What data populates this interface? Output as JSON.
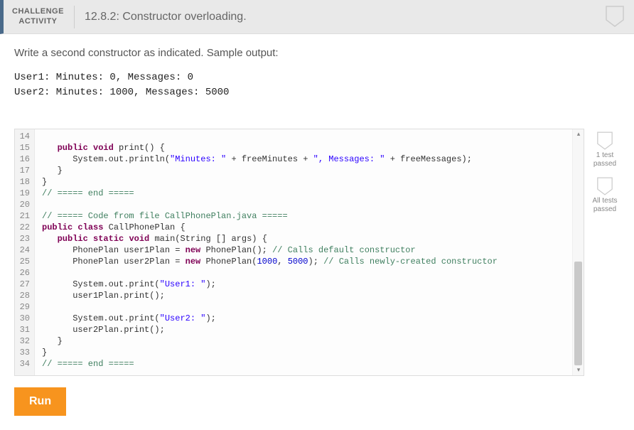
{
  "header": {
    "label_line1": "CHALLENGE",
    "label_line2": "ACTIVITY",
    "title": "12.8.2: Constructor overloading."
  },
  "instructions": "Write a second constructor as indicated. Sample output:",
  "sample_output": "User1: Minutes: 0, Messages: 0\nUser2: Minutes: 1000, Messages: 5000",
  "editor": {
    "first_line_number": 14,
    "lines": [
      [],
      [
        [
          "   ",
          ""
        ],
        [
          "public",
          "kw"
        ],
        [
          " ",
          ""
        ],
        [
          "void",
          "kw"
        ],
        [
          " print() {",
          ""
        ]
      ],
      [
        [
          "      System.out.println(",
          ""
        ],
        [
          "\"Minutes: \"",
          "str"
        ],
        [
          " + freeMinutes + ",
          ""
        ],
        [
          "\", Messages: \"",
          "str"
        ],
        [
          " + freeMessages);",
          ""
        ]
      ],
      [
        [
          "   }",
          ""
        ]
      ],
      [
        [
          "}",
          ""
        ]
      ],
      [
        [
          "// ===== end =====",
          "cmt"
        ]
      ],
      [],
      [
        [
          "// ===== Code from file CallPhonePlan.java =====",
          "cmt"
        ]
      ],
      [
        [
          "public",
          "kw"
        ],
        [
          " ",
          ""
        ],
        [
          "class",
          "kw"
        ],
        [
          " CallPhonePlan {",
          ""
        ]
      ],
      [
        [
          "   ",
          ""
        ],
        [
          "public",
          "kw"
        ],
        [
          " ",
          ""
        ],
        [
          "static",
          "kw"
        ],
        [
          " ",
          ""
        ],
        [
          "void",
          "kw"
        ],
        [
          " main(String [] args) {",
          ""
        ]
      ],
      [
        [
          "      PhonePlan user1Plan = ",
          ""
        ],
        [
          "new",
          "kw"
        ],
        [
          " PhonePlan(); ",
          ""
        ],
        [
          "// Calls default constructor",
          "cmt"
        ]
      ],
      [
        [
          "      PhonePlan user2Plan = ",
          ""
        ],
        [
          "new",
          "kw"
        ],
        [
          " PhonePlan(",
          ""
        ],
        [
          "1000",
          "num"
        ],
        [
          ", ",
          ""
        ],
        [
          "5000",
          "num"
        ],
        [
          "); ",
          ""
        ],
        [
          "// Calls newly-created constructor",
          "cmt"
        ]
      ],
      [],
      [
        [
          "      System.out.print(",
          ""
        ],
        [
          "\"User1: \"",
          "str"
        ],
        [
          ");",
          ""
        ]
      ],
      [
        [
          "      user1Plan.print();",
          ""
        ]
      ],
      [],
      [
        [
          "      System.out.print(",
          ""
        ],
        [
          "\"User2: \"",
          "str"
        ],
        [
          ");",
          ""
        ]
      ],
      [
        [
          "      user2Plan.print();",
          ""
        ]
      ],
      [
        [
          "   }",
          ""
        ]
      ],
      [
        [
          "}",
          ""
        ]
      ],
      [
        [
          "// ===== end =====",
          "cmt"
        ]
      ]
    ]
  },
  "status": {
    "test1": "1 test passed",
    "test_all": "All tests passed"
  },
  "run_label": "Run"
}
